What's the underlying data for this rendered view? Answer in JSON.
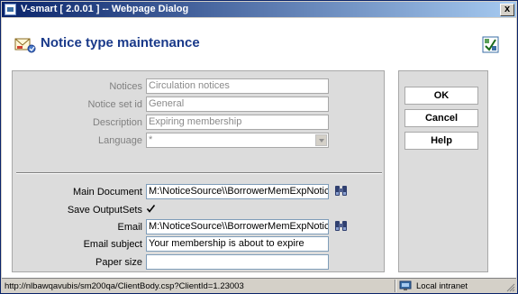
{
  "window": {
    "title": "V-smart [ 2.0.01 ] -- Webpage Dialog",
    "close_label": "x"
  },
  "header": {
    "title": "Notice type maintenance",
    "icons": {
      "left": "notice-envelope-icon",
      "right": "help-check-icon"
    }
  },
  "form": {
    "notices": {
      "label": "Notices",
      "value": "Circulation notices",
      "enabled": false
    },
    "notice_set_id": {
      "label": "Notice set id",
      "value": "General",
      "enabled": false
    },
    "description": {
      "label": "Description",
      "value": "Expiring membership",
      "enabled": false
    },
    "language": {
      "label": "Language",
      "value": "*",
      "enabled": false
    },
    "main_document": {
      "label": "Main Document",
      "value": "M:\\NoticeSource\\\\BorrowerMemExpNotice.doc"
    },
    "save_outputsets": {
      "label": "Save OutputSets",
      "checked": true
    },
    "email": {
      "label": "Email",
      "value": "M:\\NoticeSource\\\\BorrowerMemExpNotice.doc"
    },
    "email_subject": {
      "label": "Email subject",
      "value": "Your membership is about to expire"
    },
    "paper_size": {
      "label": "Paper size",
      "value": ""
    }
  },
  "buttons": {
    "ok": "OK",
    "cancel": "Cancel",
    "help": "Help"
  },
  "statusbar": {
    "url": "http://nlbawqavubis/sm200qa/ClientBody.csp?ClientId=1.23003",
    "zone": "Local intranet"
  },
  "colors": {
    "title_gradient_start": "#0a246a",
    "title_gradient_end": "#a6caf0",
    "heading": "#1a3a8a",
    "panel": "#dcdcdc",
    "chrome": "#d4d0c8"
  }
}
